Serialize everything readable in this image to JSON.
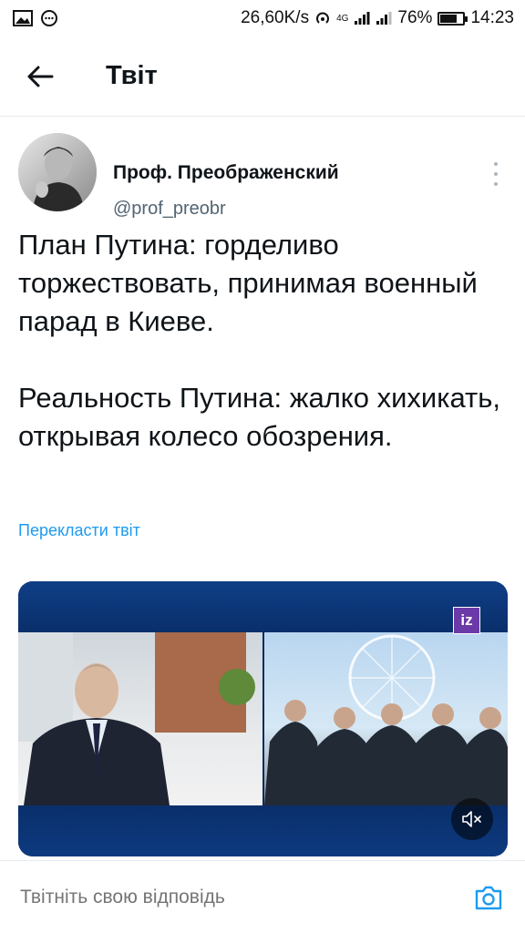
{
  "status_bar": {
    "left_icons": [
      "image-icon",
      "chat-bubble-icon"
    ],
    "speed": "26,60K/s",
    "network": "4G",
    "battery": "76%",
    "battery_level": 0.76,
    "time": "14:23"
  },
  "header": {
    "back_icon": "arrow-left-icon",
    "title": "Твіт"
  },
  "tweet": {
    "author_name": "Проф. Преображенский",
    "author_handle": "@prof_preobr",
    "paragraphs": [
      "План Путина: горделиво торжествовать, принимая военный парад в Киеве.",
      "Реальность Путина: жалко хихикать, открывая колесо обозрения."
    ],
    "translate_label": "Перекласти твіт",
    "media": {
      "logo_text": "iz",
      "mute_icon": "speaker-muted-icon"
    }
  },
  "reply": {
    "placeholder": "Твітніть свою відповідь",
    "camera_icon": "camera-icon"
  },
  "colors": {
    "accent": "#1d9bf0",
    "text": "#0f1419",
    "secondary": "#536471"
  }
}
